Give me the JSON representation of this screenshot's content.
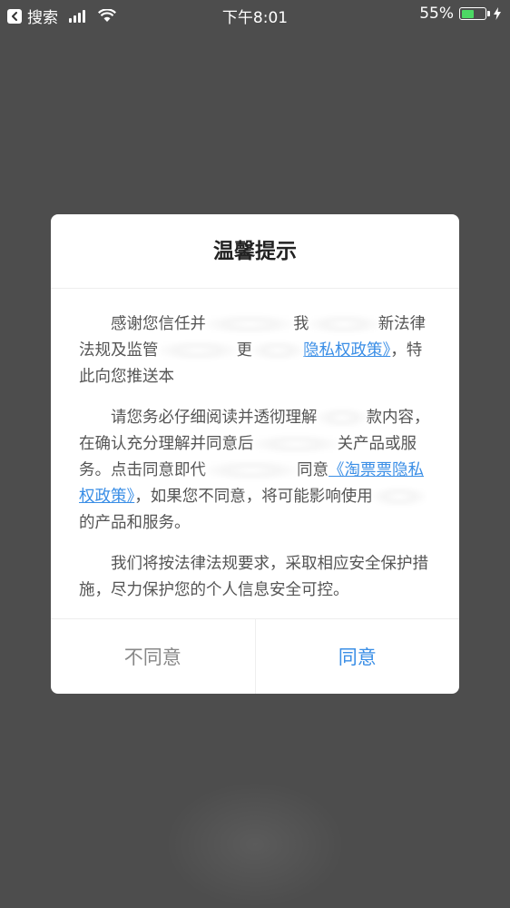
{
  "status_bar": {
    "back_app": "搜索",
    "time": "下午8:01",
    "battery": "55%",
    "battery_level": 0.55,
    "battery_color": "#4cd964"
  },
  "dialog": {
    "title": "温馨提示",
    "paragraphs": [
      {
        "part1": "感谢您信任并",
        "part2": "我",
        "part3": "新",
        "part4": "法律法规及监管",
        "part5": "更",
        "link": "隐私权政策》",
        "part6": "，特此向您推送本"
      },
      {
        "part1": "请您务必仔细阅读并透彻理解",
        "part2": "款内",
        "part3": "容，在确认充分理解并同意后",
        "part4": "关产品或服务。点击同意即代",
        "part5": "同意",
        "link": "《淘票票隐私权政策》",
        "part6": "，如果您不同",
        "part7": "意，将可能影响使用",
        "part8": "的产品和服务。"
      },
      {
        "text": "我们将按法律法规要求，采取相应安全保护措施，尽力保护您的个人信息安全可控。"
      }
    ],
    "decline_label": "不同意",
    "agree_label": "同意",
    "link_color": "#3a8ee6"
  }
}
